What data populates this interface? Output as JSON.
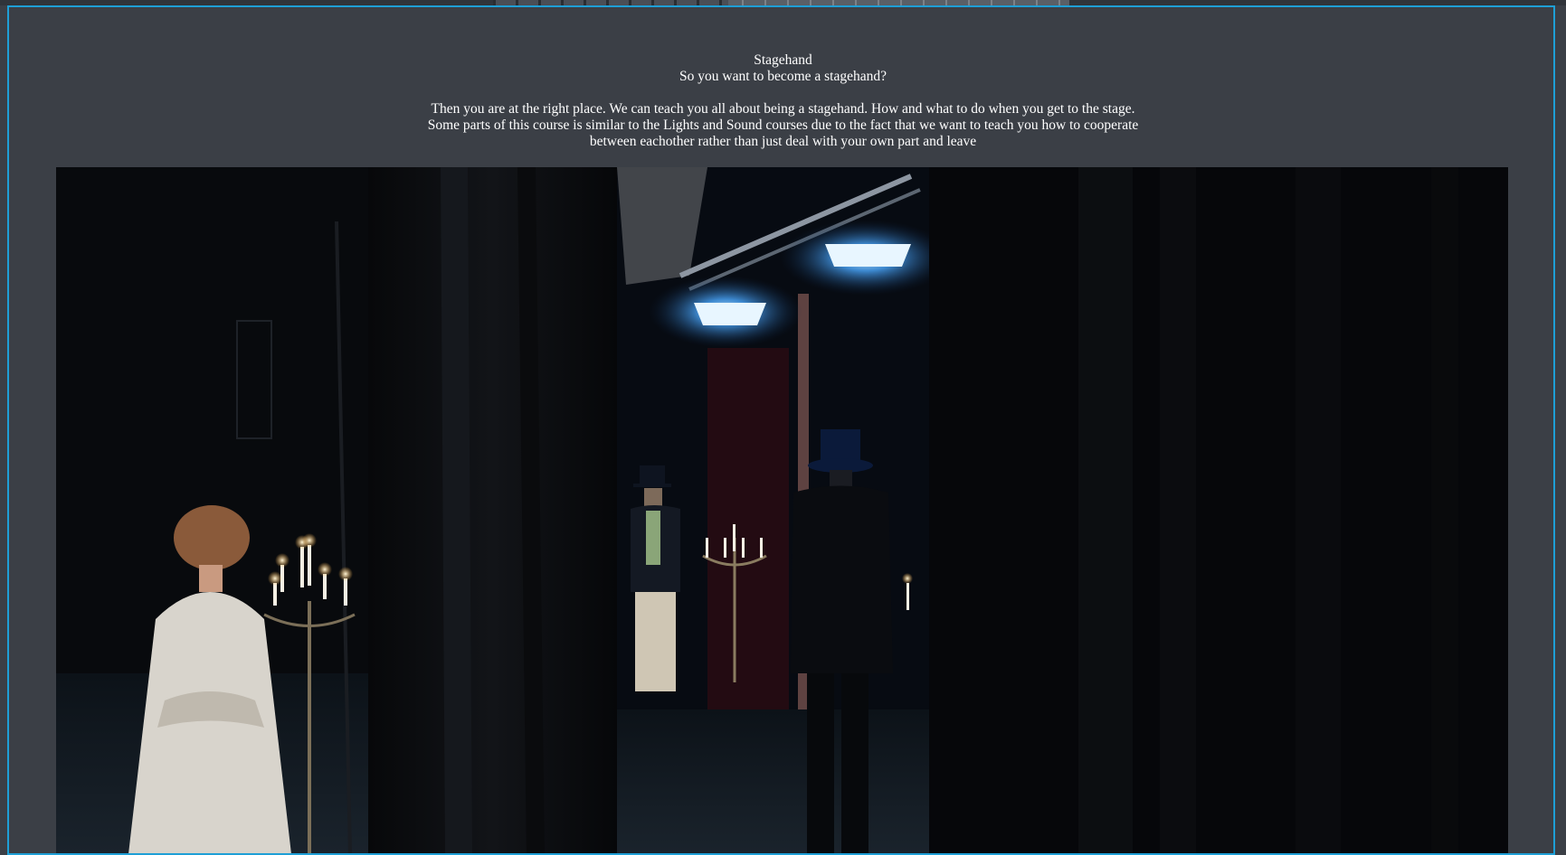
{
  "page": {
    "title": "Stagehand",
    "subtitle": "So you want to become a stagehand?",
    "intro": "Then you are at the right place. We can teach you all about being a stagehand. How and what to do when you get to the stage. Some parts of this course is similar to the Lights and Sound courses due to the fact that we want to teach you how to cooperate between eachother rather than just deal with your own part and leave"
  },
  "colors": {
    "background": "#3b3f46",
    "frame_border": "#1e9fd6",
    "text": "#ffffff",
    "stage_light": "#5fb8ff"
  }
}
